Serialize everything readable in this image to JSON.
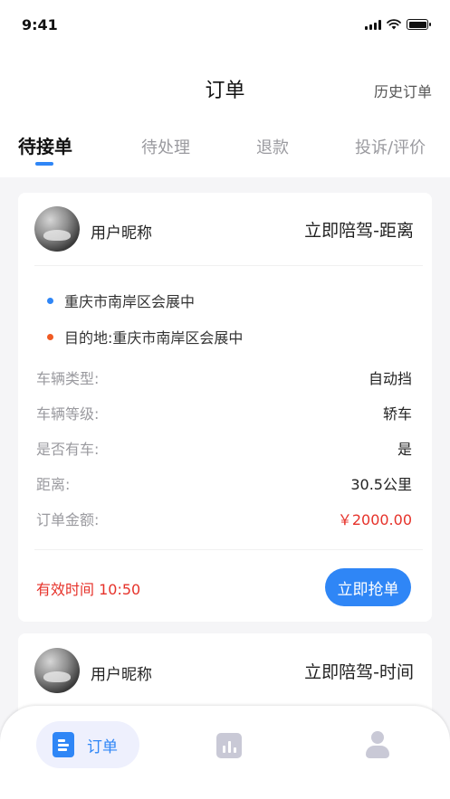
{
  "status_bar": {
    "time": "9:41"
  },
  "nav": {
    "title": "订单",
    "history": "历史订单"
  },
  "tabs": [
    {
      "label": "待接单",
      "active": true
    },
    {
      "label": "待处理",
      "active": false
    },
    {
      "label": "退款",
      "active": false
    },
    {
      "label": "投诉/评价",
      "active": false
    }
  ],
  "orders": [
    {
      "user_name": "用户昵称",
      "service_type": "立即陪驾-距离",
      "start_address": "重庆市南岸区会展中",
      "destination": "目的地:重庆市南岸区会展中",
      "details": [
        {
          "label": "车辆类型:",
          "value": "自动挡"
        },
        {
          "label": "车辆等级:",
          "value": "轿车"
        },
        {
          "label": "是否有车:",
          "value": "是"
        },
        {
          "label": "距离:",
          "value": "30.5公里"
        },
        {
          "label": "订单金额:",
          "value": "￥2000.00"
        }
      ],
      "valid_time": "有效时间 10:50",
      "action": "立即抢单"
    },
    {
      "user_name": "用户昵称",
      "service_type": "立即陪驾-时间"
    }
  ],
  "tabbar": {
    "orders_label": "订单"
  },
  "colors": {
    "accent": "#2f86f6",
    "price": "#e6322a",
    "start_dot": "#2f86f6",
    "end_dot": "#f05a23"
  }
}
